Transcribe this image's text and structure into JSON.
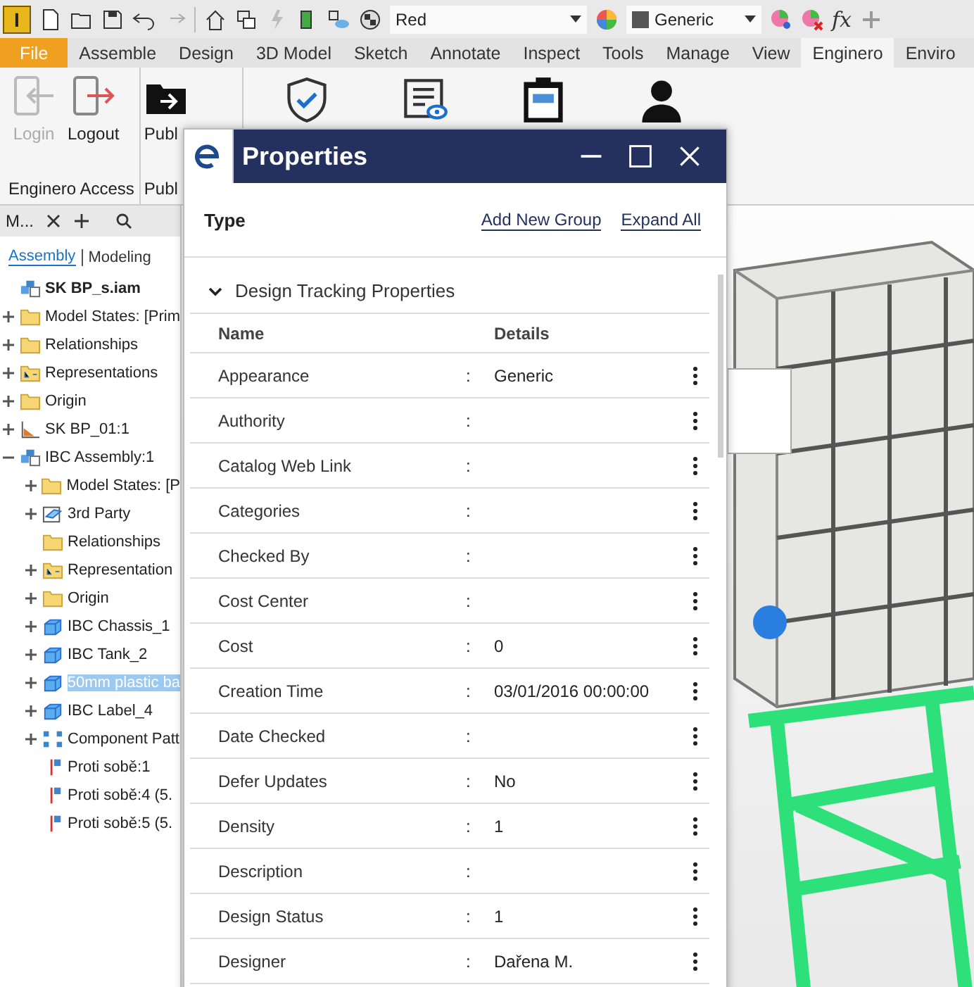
{
  "toolbar": {
    "app_letter": "I",
    "material": "Red",
    "appearance": "Generic",
    "function_label": "fx"
  },
  "ribbon_tabs": [
    {
      "label": "File",
      "kind": "file",
      "selected": false
    },
    {
      "label": "Assemble",
      "kind": "tab",
      "selected": false
    },
    {
      "label": "Design",
      "kind": "tab",
      "selected": false
    },
    {
      "label": "3D Model",
      "kind": "tab",
      "selected": false
    },
    {
      "label": "Sketch",
      "kind": "tab",
      "selected": false
    },
    {
      "label": "Annotate",
      "kind": "tab",
      "selected": false
    },
    {
      "label": "Inspect",
      "kind": "tab",
      "selected": false
    },
    {
      "label": "Tools",
      "kind": "tab",
      "selected": false
    },
    {
      "label": "Manage",
      "kind": "tab",
      "selected": false
    },
    {
      "label": "View",
      "kind": "tab",
      "selected": false
    },
    {
      "label": "Enginero",
      "kind": "tab",
      "selected": true
    },
    {
      "label": "Enviro",
      "kind": "tab",
      "selected": false
    }
  ],
  "ribbon_panel": {
    "login": {
      "label": "Login",
      "disabled": true
    },
    "logout": {
      "label": "Logout",
      "disabled": false
    },
    "publish": {
      "label": "Publ"
    },
    "groups": [
      "Enginero Access",
      "Publ"
    ]
  },
  "browser": {
    "tab_label": "M...",
    "modes": [
      {
        "label": "Assembly",
        "selected": true
      },
      {
        "label": "Modeling",
        "selected": false
      }
    ],
    "tree": [
      {
        "label": "SK BP_s.iam",
        "kind": "assembly",
        "selected": false,
        "children": [
          {
            "label": "Model States: [Prim",
            "kind": "folder",
            "expanded": false,
            "selected": false
          },
          {
            "label": "Relationships",
            "kind": "folder",
            "expanded": false,
            "selected": false
          },
          {
            "label": "Representations",
            "kind": "rep",
            "expanded": false,
            "selected": false
          },
          {
            "label": "Origin",
            "kind": "folder",
            "expanded": false,
            "selected": false
          },
          {
            "label": "SK BP_01:1",
            "kind": "sketch",
            "expanded": false,
            "selected": false
          },
          {
            "label": "IBC Assembly:1",
            "kind": "assembly",
            "expanded": true,
            "selected": false,
            "children": [
              {
                "label": "Model States: [P",
                "kind": "folder",
                "expanded": false,
                "selected": false
              },
              {
                "label": "3rd Party",
                "kind": "link",
                "expanded": false,
                "selected": false
              },
              {
                "label": "Relationships",
                "kind": "folder",
                "selected": false
              },
              {
                "label": "Representation",
                "kind": "rep",
                "expanded": false,
                "selected": false
              },
              {
                "label": "Origin",
                "kind": "folder",
                "expanded": false,
                "selected": false
              },
              {
                "label": "IBC Chassis_1",
                "kind": "part",
                "expanded": false,
                "selected": false
              },
              {
                "label": "IBC Tank_2",
                "kind": "part",
                "expanded": false,
                "selected": false
              },
              {
                "label": "50mm plastic ba",
                "kind": "part",
                "expanded": false,
                "selected": true
              },
              {
                "label": "IBC Label_4",
                "kind": "part",
                "expanded": false,
                "selected": false
              },
              {
                "label": "Component Patt",
                "kind": "pattern",
                "expanded": false,
                "selected": false
              },
              {
                "label": "Proti sobě:1",
                "kind": "constraint",
                "selected": false
              },
              {
                "label": "Proti sobě:4 (5.",
                "kind": "constraint",
                "selected": false
              },
              {
                "label": "Proti sobě:5 (5.",
                "kind": "constraint",
                "selected": false
              }
            ]
          }
        ]
      }
    ]
  },
  "properties_window": {
    "title": "Properties",
    "type_label": "Type",
    "actions": [
      "Add New Group",
      "Expand All"
    ],
    "section": {
      "title": "Design Tracking Properties",
      "expanded": true,
      "columns": [
        "Name",
        "Details"
      ],
      "rows": [
        {
          "name": "Appearance",
          "separator": ":",
          "value": "Generic"
        },
        {
          "name": "Authority",
          "separator": ":",
          "value": ""
        },
        {
          "name": "Catalog Web Link",
          "separator": ":",
          "value": ""
        },
        {
          "name": "Categories",
          "separator": ":",
          "value": ""
        },
        {
          "name": "Checked By",
          "separator": ":",
          "value": ""
        },
        {
          "name": "Cost Center",
          "separator": ":",
          "value": ""
        },
        {
          "name": "Cost",
          "separator": ":",
          "value": "0"
        },
        {
          "name": "Creation Time",
          "separator": ":",
          "value": "03/01/2016 00:00:00"
        },
        {
          "name": "Date Checked",
          "separator": ":",
          "value": ""
        },
        {
          "name": "Defer Updates",
          "separator": ":",
          "value": "No"
        },
        {
          "name": "Density",
          "separator": ":",
          "value": "1"
        },
        {
          "name": "Description",
          "separator": ":",
          "value": ""
        },
        {
          "name": "Design Status",
          "separator": ":",
          "value": "1"
        },
        {
          "name": "Designer",
          "separator": ":",
          "value": "Dařena M."
        }
      ]
    }
  }
}
